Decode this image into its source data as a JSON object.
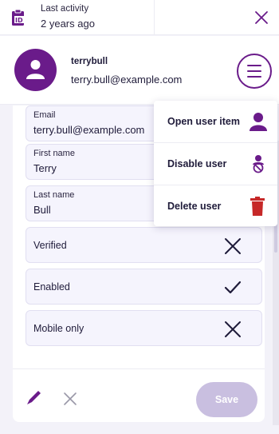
{
  "topbar": {
    "activity_label": "Last activity",
    "activity_value": "2 years ago",
    "badge_icon": "clipboard-id-icon",
    "close_icon": "close-icon"
  },
  "user": {
    "username": "terrybull",
    "email": "terry.bull@example.com",
    "avatar_icon": "user-icon"
  },
  "menu": {
    "icon": "hamburger-menu-icon",
    "items": [
      {
        "label": "Open user item",
        "icon": "user-icon"
      },
      {
        "label": "Disable user",
        "icon": "disable-user-icon"
      },
      {
        "label": "Delete user",
        "icon": "trash-icon"
      }
    ]
  },
  "form": {
    "fields": [
      {
        "label": "Email",
        "value": "terry.bull@example.com"
      },
      {
        "label": "First name",
        "value": "Terry"
      },
      {
        "label": "Last name",
        "value": "Bull"
      }
    ],
    "toggles": [
      {
        "label": "Verified",
        "checked": false
      },
      {
        "label": "Enabled",
        "checked": true
      },
      {
        "label": "Mobile only",
        "checked": false
      }
    ]
  },
  "footer": {
    "edit_icon": "pencil-icon",
    "cancel_icon": "close-icon",
    "save_label": "Save"
  },
  "colors": {
    "accent": "#6a1b8a",
    "danger": "#c62828",
    "save_disabled": "#c9bfe0",
    "field_bg": "#f5f4fd"
  }
}
